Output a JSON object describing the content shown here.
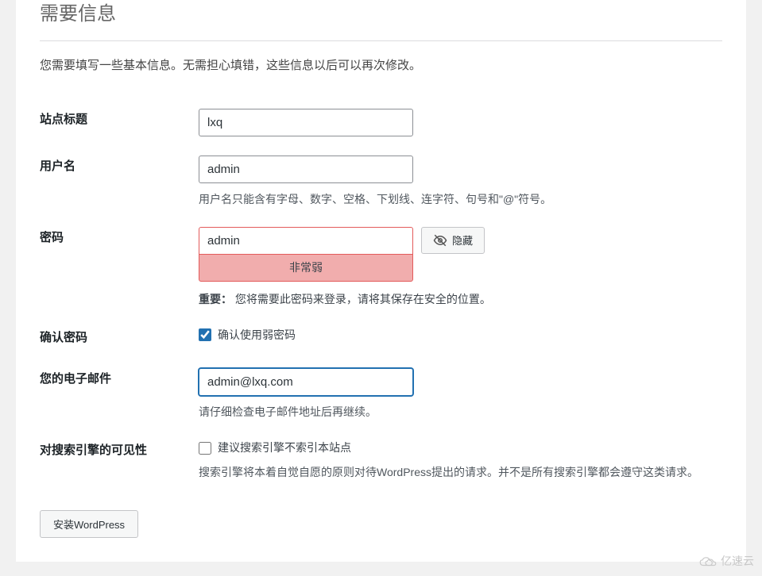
{
  "section_title": "需要信息",
  "intro_text": "您需要填写一些基本信息。无需担心填错，这些信息以后可以再次修改。",
  "fields": {
    "site_title": {
      "label": "站点标题",
      "value": "lxq"
    },
    "username": {
      "label": "用户名",
      "value": "admin",
      "hint": "用户名只能含有字母、数字、空格、下划线、连字符、句号和\"@\"符号。"
    },
    "password": {
      "label": "密码",
      "value": "admin",
      "strength": "非常弱",
      "hide_button": "隐藏",
      "important_label": "重要：",
      "important_text": "您将需要此密码来登录，请将其保存在安全的位置。"
    },
    "confirm_password": {
      "label": "确认密码",
      "checkbox_label": "确认使用弱密码",
      "checked": true
    },
    "email": {
      "label": "您的电子邮件",
      "value": "admin@lxq.com",
      "hint": "请仔细检查电子邮件地址后再继续。"
    },
    "search_visibility": {
      "label": "对搜索引擎的可见性",
      "checkbox_label": "建议搜索引擎不索引本站点",
      "checked": false,
      "hint": "搜索引擎将本着自觉自愿的原则对待WordPress提出的请求。并不是所有搜索引擎都会遵守这类请求。"
    }
  },
  "submit_button": "安装WordPress",
  "watermark": "亿速云"
}
